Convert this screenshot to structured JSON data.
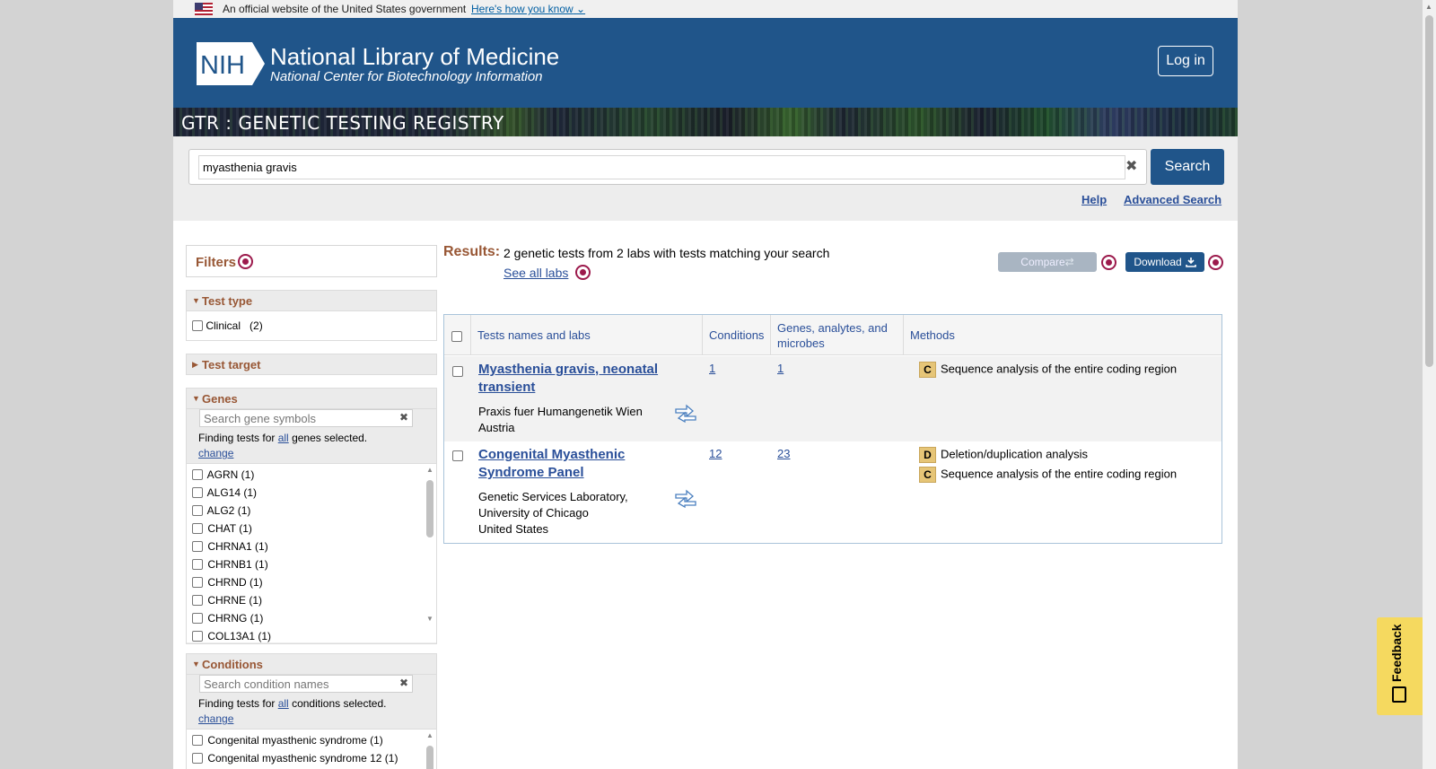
{
  "gov_banner": {
    "text": "An official website of the United States government",
    "link": "Here's how you know"
  },
  "header": {
    "logo_text": "NIH",
    "title": "National Library of Medicine",
    "subtitle": "National Center for Biotechnology Information",
    "login": "Log in"
  },
  "gtr_banner": {
    "title": "GTR : GENETIC TESTING REGISTRY"
  },
  "search": {
    "value": "myasthenia gravis",
    "button": "Search",
    "help": "Help",
    "advanced": "Advanced Search"
  },
  "filters": {
    "label": "Filters",
    "test_type": {
      "heading": "Test type",
      "option": "Clinical",
      "count": "(2)"
    },
    "test_target": {
      "heading": "Test target"
    },
    "genes": {
      "heading": "Genes",
      "placeholder": "Search gene symbols",
      "finding_pre": "Finding tests for",
      "finding_link": "all",
      "finding_post": "genes selected.",
      "change": "change",
      "items": [
        "AGRN (1)",
        "ALG14 (1)",
        "ALG2 (1)",
        "CHAT (1)",
        "CHRNA1 (1)",
        "CHRNB1 (1)",
        "CHRND (1)",
        "CHRNE (1)",
        "CHRNG (1)",
        "COL13A1 (1)"
      ]
    },
    "conditions": {
      "heading": "Conditions",
      "placeholder": "Search condition names",
      "finding_pre": "Finding tests for",
      "finding_link": "all",
      "finding_post": "conditions selected.",
      "change": "change",
      "items": [
        "Congenital myasthenic syndrome (1)",
        "Congenital myasthenic syndrome 12 (1)"
      ]
    }
  },
  "results": {
    "label": "Results:",
    "summary": "2 genetic tests from 2 labs with tests matching your search",
    "see_all": "See all labs",
    "compare": "Compare",
    "download": "Download",
    "columns": [
      "Tests names and labs",
      "Conditions",
      "Genes, analytes, and microbes",
      "Methods"
    ],
    "rows": [
      {
        "title": "Myasthenia gravis, neonatal transient",
        "lab": "Praxis fuer Humangenetik Wien",
        "country": "Austria",
        "conditions": "1",
        "genes": "1",
        "methods": [
          {
            "badge": "C",
            "text": "Sequence analysis of the entire coding region"
          }
        ]
      },
      {
        "title": "Congenital Myasthenic Syndrome Panel",
        "lab": "Genetic Services Laboratory, University of Chicago",
        "country": "United States",
        "conditions": "12",
        "genes": "23",
        "methods": [
          {
            "badge": "D",
            "text": "Deletion/duplication analysis"
          },
          {
            "badge": "C",
            "text": "Sequence analysis of the entire coding region"
          }
        ]
      }
    ]
  },
  "feedback": "Feedback",
  "colors": {
    "header_blue": "#20558a",
    "accent_brown": "#985735",
    "link_blue": "#2a4f99",
    "info_maroon": "#9c1a4c",
    "feedback_yellow": "#f5d95f",
    "badge_tan": "#e6c577"
  }
}
